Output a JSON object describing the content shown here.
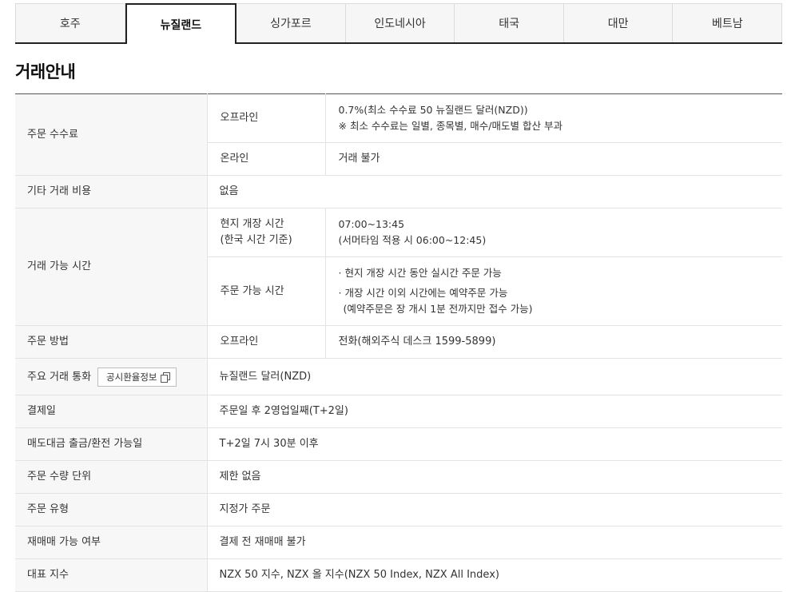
{
  "tabs": [
    {
      "label": "호주"
    },
    {
      "label": "뉴질랜드"
    },
    {
      "label": "싱가포르"
    },
    {
      "label": "인도네시아"
    },
    {
      "label": "태국"
    },
    {
      "label": "대만"
    },
    {
      "label": "베트남"
    }
  ],
  "active_tab": "뉴질랜드",
  "section_title": "거래안내",
  "rows": {
    "fee": {
      "label": "주문 수수료",
      "offline_label": "오프라인",
      "offline_line1": "0.7%(최소 수수료 50 뉴질랜드 달러(NZD))",
      "offline_line2": "※ 최소 수수료는 일별, 종목별, 매수/매도별 합산 부과",
      "online_label": "온라인",
      "online_value": "거래 불가"
    },
    "other_cost": {
      "label": "기타 거래 비용",
      "value": "없음"
    },
    "trading_hours": {
      "label": "거래 가능 시간",
      "local_label_1": "현지 개장 시간",
      "local_label_2": "(한국 시간 기준)",
      "local_value_1": "07:00~13:45",
      "local_value_2": "(서머타임 적용 시 06:00~12:45)",
      "order_label": "주문 가능 시간",
      "order_line1": "· 현지 개장 시간 동안 실시간 주문 가능",
      "order_line2": "· 개장 시간 이외 시간에는 예약주문 가능",
      "order_line3": "(예약주문은 장 개시 1분 전까지만 접수 가능)"
    },
    "order_method": {
      "label": "주문 방법",
      "sub_label": "오프라인",
      "value": "전화(해외주식 데스크 1599-5899)"
    },
    "currency": {
      "label": "주요 거래 통화",
      "button_label": "공시환율정보",
      "value": "뉴질랜드 달러(NZD)"
    },
    "settlement": {
      "label": "결제일",
      "value": "주문일 후 2영업일째(T+2일)"
    },
    "withdrawal": {
      "label": "매도대금 출금/환전 가능일",
      "value": "T+2일 7시 30분 이후"
    },
    "quantity_unit": {
      "label": "주문 수량 단위",
      "value": "제한 없음"
    },
    "order_type": {
      "label": "주문 유형",
      "value": "지정가 주문"
    },
    "resale": {
      "label": "재매매 가능 여부",
      "value": "결제 전 재매매 불가"
    },
    "index": {
      "label": "대표 지수",
      "value": "NZX 50 지수, NZX 올 지수(NZX 50 Index, NZX All Index)"
    }
  },
  "colors": {
    "border_dark": "#222222",
    "header_bg": "#f7f7f7",
    "tab_bg": "#f6f6f6",
    "line": "#e3e3e3"
  }
}
